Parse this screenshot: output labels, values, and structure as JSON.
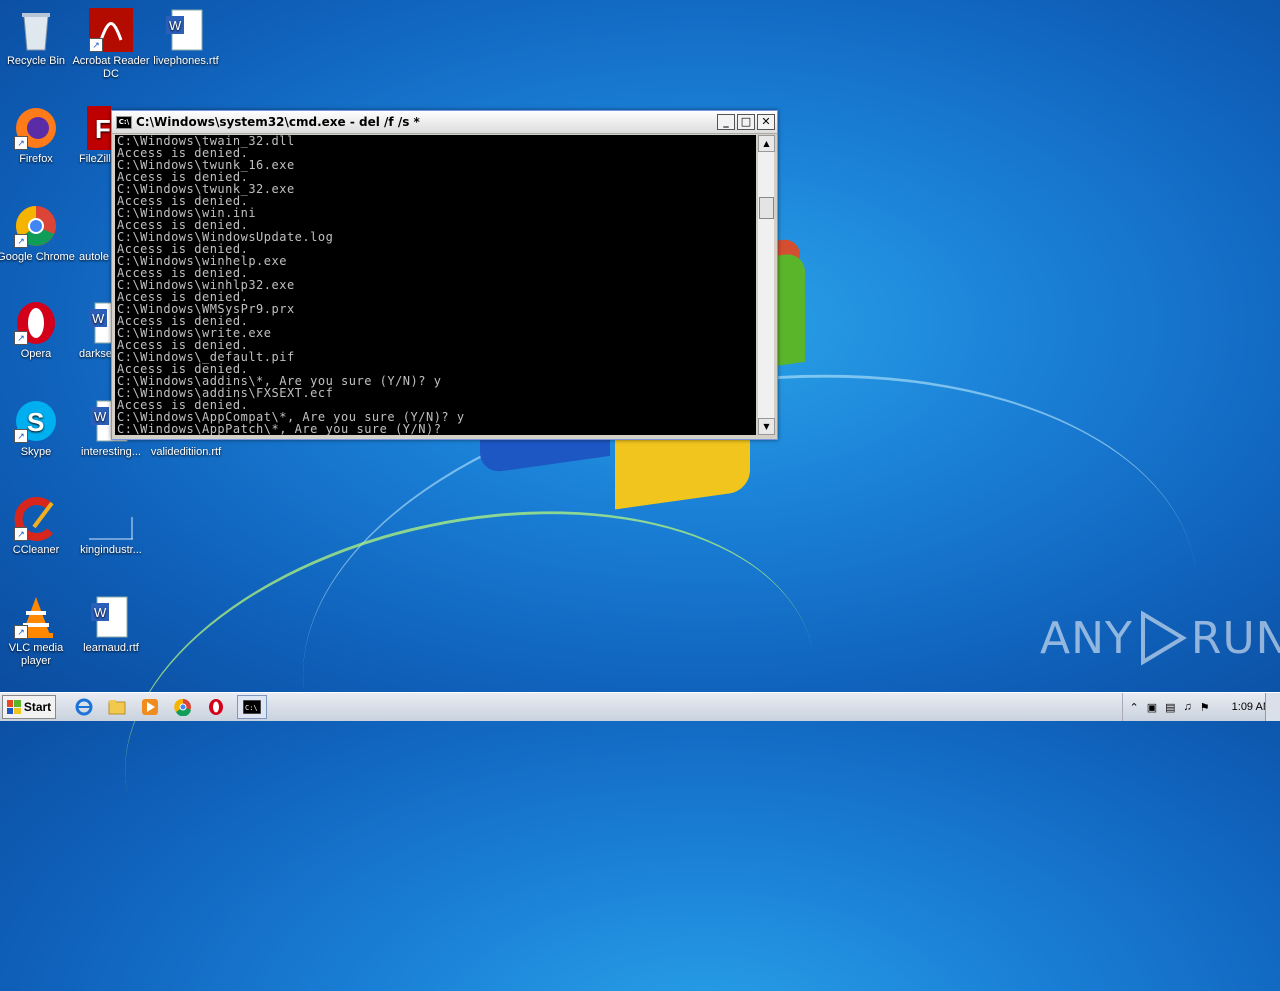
{
  "desktop": {
    "icons": [
      {
        "label": "Recycle Bin",
        "icon": "recycle-bin-icon"
      },
      {
        "label": "Acrobat Reader DC",
        "icon": "acrobat-icon"
      },
      {
        "label": "livephones.rtf",
        "icon": "word-doc-icon"
      },
      {
        "label": "Firefox",
        "icon": "firefox-icon"
      },
      {
        "label": "FileZilla",
        "icon": "filezilla-icon"
      },
      {
        "label": "Google Chrome",
        "icon": "chrome-icon"
      },
      {
        "label": "autole",
        "icon": "doc-icon"
      },
      {
        "label": "Opera",
        "icon": "opera-icon"
      },
      {
        "label": "darkse",
        "icon": "word-doc-icon"
      },
      {
        "label": "Skype",
        "icon": "skype-icon"
      },
      {
        "label": "interesting...",
        "icon": "word-doc-icon"
      },
      {
        "label": "valideditiion.rtf",
        "icon": "word-doc-icon"
      },
      {
        "label": "CCleaner",
        "icon": "ccleaner-icon"
      },
      {
        "label": "kingindustr...",
        "icon": "doc-icon"
      },
      {
        "label": "VLC media player",
        "icon": "vlc-icon"
      },
      {
        "label": "learnaud.rtf",
        "icon": "word-doc-icon"
      }
    ]
  },
  "cmd": {
    "title": "C:\\Windows\\system32\\cmd.exe - del  /f /s *",
    "lines": [
      "C:\\Windows\\twain_32.dll",
      "Access is denied.",
      "C:\\Windows\\twunk_16.exe",
      "Access is denied.",
      "C:\\Windows\\twunk_32.exe",
      "Access is denied.",
      "C:\\Windows\\win.ini",
      "Access is denied.",
      "C:\\Windows\\WindowsUpdate.log",
      "Access is denied.",
      "C:\\Windows\\winhelp.exe",
      "Access is denied.",
      "C:\\Windows\\winhlp32.exe",
      "Access is denied.",
      "C:\\Windows\\WMSysPr9.prx",
      "Access is denied.",
      "C:\\Windows\\write.exe",
      "Access is denied.",
      "C:\\Windows\\_default.pif",
      "Access is denied.",
      "C:\\Windows\\addins\\*, Are you sure (Y/N)? y",
      "C:\\Windows\\addins\\FXSEXT.ecf",
      "Access is denied.",
      "C:\\Windows\\AppCompat\\*, Are you sure (Y/N)? y",
      "C:\\Windows\\AppPatch\\*, Are you sure (Y/N)?"
    ]
  },
  "watermark": {
    "left": "ANY",
    "right": "RUN"
  },
  "taskbar": {
    "start_label": "Start",
    "items": [
      "ie-icon",
      "explorer-icon",
      "media-player-icon",
      "chrome-icon",
      "opera-icon",
      "cmd-icon"
    ],
    "clock": "1:09 AM"
  },
  "colors": {
    "cmd_bg": "#000000",
    "cmd_text": "#c0c0c0",
    "desktop": "#1a7fd6"
  }
}
